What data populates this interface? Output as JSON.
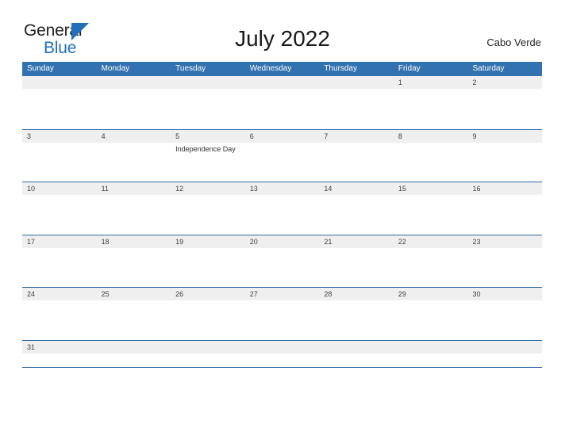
{
  "brand": {
    "word_one": "General",
    "word_two": "Blue",
    "triangle_icon": "blue-triangle-icon",
    "color_dark": "#231f20",
    "color_blue": "#1f70b8"
  },
  "header": {
    "title": "July 2022",
    "location": "Cabo Verde"
  },
  "theme": {
    "header_blue": "#3372b0",
    "row_rule_blue": "#2d6da8",
    "day_band_gray": "#efefef",
    "page_background": "#ffffff"
  },
  "calendar": {
    "month": "July",
    "year": "2022",
    "weekday_headers": [
      "Sunday",
      "Monday",
      "Tuesday",
      "Wednesday",
      "Thursday",
      "Friday",
      "Saturday"
    ],
    "weeks": [
      [
        {
          "date": "",
          "events": []
        },
        {
          "date": "",
          "events": []
        },
        {
          "date": "",
          "events": []
        },
        {
          "date": "",
          "events": []
        },
        {
          "date": "",
          "events": []
        },
        {
          "date": "1",
          "events": []
        },
        {
          "date": "2",
          "events": []
        }
      ],
      [
        {
          "date": "3",
          "events": []
        },
        {
          "date": "4",
          "events": []
        },
        {
          "date": "5",
          "events": [
            "Independence Day"
          ]
        },
        {
          "date": "6",
          "events": []
        },
        {
          "date": "7",
          "events": []
        },
        {
          "date": "8",
          "events": []
        },
        {
          "date": "9",
          "events": []
        }
      ],
      [
        {
          "date": "10",
          "events": []
        },
        {
          "date": "11",
          "events": []
        },
        {
          "date": "12",
          "events": []
        },
        {
          "date": "13",
          "events": []
        },
        {
          "date": "14",
          "events": []
        },
        {
          "date": "15",
          "events": []
        },
        {
          "date": "16",
          "events": []
        }
      ],
      [
        {
          "date": "17",
          "events": []
        },
        {
          "date": "18",
          "events": []
        },
        {
          "date": "19",
          "events": []
        },
        {
          "date": "20",
          "events": []
        },
        {
          "date": "21",
          "events": []
        },
        {
          "date": "22",
          "events": []
        },
        {
          "date": "23",
          "events": []
        }
      ],
      [
        {
          "date": "24",
          "events": []
        },
        {
          "date": "25",
          "events": []
        },
        {
          "date": "26",
          "events": []
        },
        {
          "date": "27",
          "events": []
        },
        {
          "date": "28",
          "events": []
        },
        {
          "date": "29",
          "events": []
        },
        {
          "date": "30",
          "events": []
        }
      ],
      [
        {
          "date": "31",
          "events": []
        },
        {
          "date": "",
          "events": []
        },
        {
          "date": "",
          "events": []
        },
        {
          "date": "",
          "events": []
        },
        {
          "date": "",
          "events": []
        },
        {
          "date": "",
          "events": []
        },
        {
          "date": "",
          "events": []
        }
      ]
    ]
  }
}
